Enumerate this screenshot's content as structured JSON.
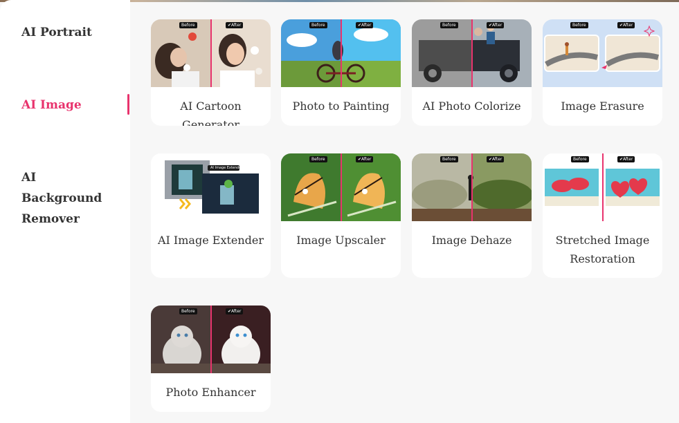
{
  "sidebar": {
    "items": [
      {
        "label": "AI Portrait",
        "active": false
      },
      {
        "label": "AI Image",
        "active": true
      },
      {
        "label": "AI Background Remover",
        "active": false
      }
    ],
    "accent_color": "#e8336d"
  },
  "tag": {
    "before": "Before",
    "after": "✔After"
  },
  "extender_badge": "AI Image Extender",
  "cards": [
    {
      "label": "AI Cartoon Generator"
    },
    {
      "label": "Photo to Painting"
    },
    {
      "label": "AI Photo Colorize"
    },
    {
      "label": "Image Erasure"
    },
    {
      "label": "AI Image Extender"
    },
    {
      "label": "Image Upscaler"
    },
    {
      "label": "Image Dehaze"
    },
    {
      "label": "Stretched Image Restoration"
    },
    {
      "label": "Photo Enhancer"
    }
  ]
}
